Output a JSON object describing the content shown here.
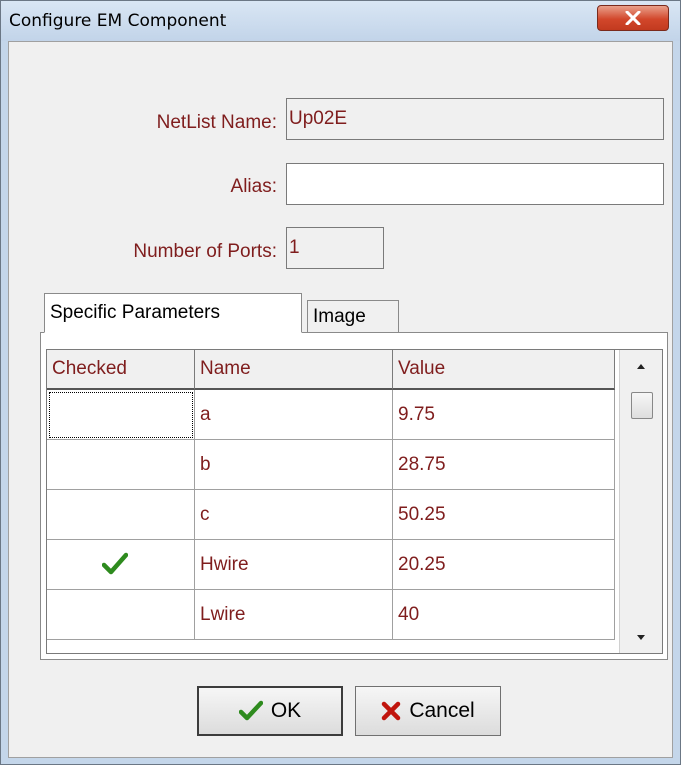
{
  "window": {
    "title": "Configure EM Component"
  },
  "form": {
    "netlist_label": "NetList Name:",
    "netlist_value": "Up02E",
    "alias_label": "Alias:",
    "alias_value": "",
    "ports_label": "Number of Ports:",
    "ports_value": "1"
  },
  "tabs": [
    {
      "label": "Specific Parameters",
      "active": true
    },
    {
      "label": "Image",
      "active": false
    }
  ],
  "grid": {
    "columns": [
      "Checked",
      "Name",
      "Value"
    ],
    "rows": [
      {
        "checked": false,
        "name": "a",
        "value": "9.75"
      },
      {
        "checked": false,
        "name": "b",
        "value": "28.75"
      },
      {
        "checked": false,
        "name": "c",
        "value": "50.25"
      },
      {
        "checked": true,
        "name": "Hwire",
        "value": "20.25"
      },
      {
        "checked": false,
        "name": "Lwire",
        "value": "40"
      }
    ]
  },
  "buttons": {
    "ok_label": "OK",
    "cancel_label": "Cancel"
  },
  "icons": {
    "close": "close-icon",
    "check": "checkmark-icon",
    "cancel": "x-icon"
  },
  "colors": {
    "label_text": "#7f1d1d",
    "check_green": "#2e8b1e",
    "cancel_red": "#c0140c",
    "close_button": "#d2472b"
  }
}
